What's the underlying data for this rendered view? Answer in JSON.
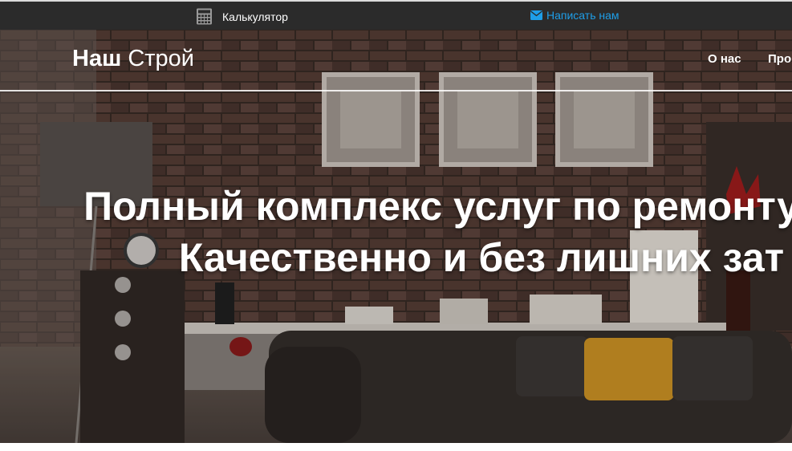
{
  "topbar": {
    "calculator_label": "Калькулятор",
    "write_us_label": "Написать нам",
    "link_color": "#1e9ee8",
    "background": "#2b2b2b"
  },
  "navbar": {
    "brand_bold": "Наш",
    "brand_rest": "Строй",
    "items": [
      {
        "label": "О нас"
      },
      {
        "label": "Про"
      }
    ]
  },
  "hero": {
    "headline_line1": "Полный комплекс услуг по ремонту",
    "headline_line2": "Качественно и без лишних зат"
  },
  "icons": {
    "calculator": "calculator-icon",
    "mail": "envelope-icon"
  }
}
